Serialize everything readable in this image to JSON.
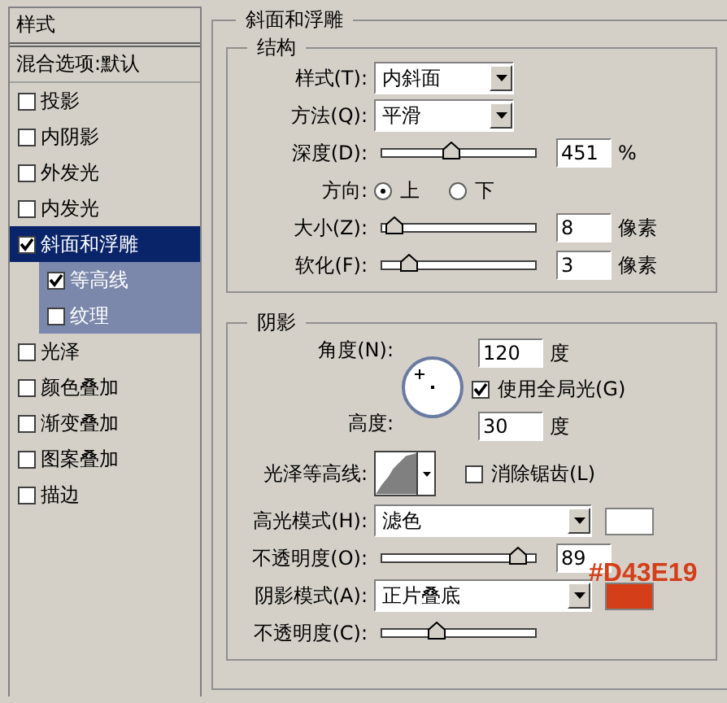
{
  "sidebar": {
    "header": "样式",
    "blend_options": "混合选项:默认",
    "items": [
      {
        "label": "投影",
        "checked": false,
        "selected": false
      },
      {
        "label": "内阴影",
        "checked": false,
        "selected": false
      },
      {
        "label": "外发光",
        "checked": false,
        "selected": false
      },
      {
        "label": "内发光",
        "checked": false,
        "selected": false
      },
      {
        "label": "斜面和浮雕",
        "checked": true,
        "selected": true,
        "children": [
          {
            "label": "等高线",
            "checked": true
          },
          {
            "label": "纹理",
            "checked": false
          }
        ]
      },
      {
        "label": "光泽",
        "checked": false,
        "selected": false
      },
      {
        "label": "颜色叠加",
        "checked": false,
        "selected": false
      },
      {
        "label": "渐变叠加",
        "checked": false,
        "selected": false
      },
      {
        "label": "图案叠加",
        "checked": false,
        "selected": false
      },
      {
        "label": "描边",
        "checked": false,
        "selected": false
      }
    ]
  },
  "panel": {
    "title": "斜面和浮雕",
    "structure": {
      "title": "结构",
      "rows": [
        {
          "kind": "select",
          "label": "样式(T):",
          "value": "内斜面"
        },
        {
          "kind": "select",
          "label": "方法(Q):",
          "value": "平滑"
        },
        {
          "kind": "slider",
          "label": "深度(D):",
          "level": 0.45,
          "value": "451",
          "unit": "%"
        },
        {
          "kind": "radio",
          "label": "方向:",
          "options": [
            {
              "label": "上",
              "selected": true
            },
            {
              "label": "下",
              "selected": false
            }
          ]
        },
        {
          "kind": "slider",
          "label": "大小(Z):",
          "level": 0.07,
          "value": "8",
          "unit": "像素"
        },
        {
          "kind": "slider",
          "label": "软化(F):",
          "level": 0.17,
          "value": "3",
          "unit": "像素"
        }
      ]
    },
    "shading": {
      "title": "阴影",
      "angle": {
        "label": "角度(N):",
        "value": "120",
        "unit": "度"
      },
      "global_light": {
        "label": "使用全局光(G)",
        "checked": true
      },
      "altitude": {
        "label": "高度:",
        "value": "30",
        "unit": "度"
      },
      "gloss_contour": {
        "label": "光泽等高线:"
      },
      "anti_aliased": {
        "label": "消除锯齿(L)",
        "checked": false
      },
      "rows": [
        {
          "kind": "select",
          "label": "高光模式(H):",
          "value": "滤色",
          "color": "#ffffff"
        },
        {
          "kind": "slider",
          "label": "不透明度(O):",
          "level": 0.88,
          "value": "89"
        },
        {
          "kind": "select",
          "label": "阴影模式(A):",
          "value": "正片叠底",
          "color": "#d43e19"
        },
        {
          "kind": "slider",
          "label": "不透明度(C):",
          "level": 0.35
        }
      ]
    }
  },
  "annotation": "#D43E19"
}
